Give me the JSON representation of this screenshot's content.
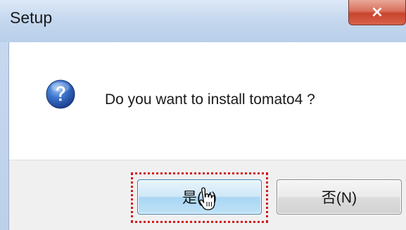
{
  "window": {
    "title": "Setup",
    "close_glyph": "×"
  },
  "dialog": {
    "icon": "question-icon",
    "message": "Do you want to install tomato4 ?"
  },
  "buttons": {
    "yes_label": "是(Y)",
    "no_label": "否(N)"
  },
  "colors": {
    "focus_ring": "#d11a1a",
    "close_button": "#c8432c",
    "icon_blue": "#2f5fb8",
    "default_button_border": "#3c7fb1"
  }
}
